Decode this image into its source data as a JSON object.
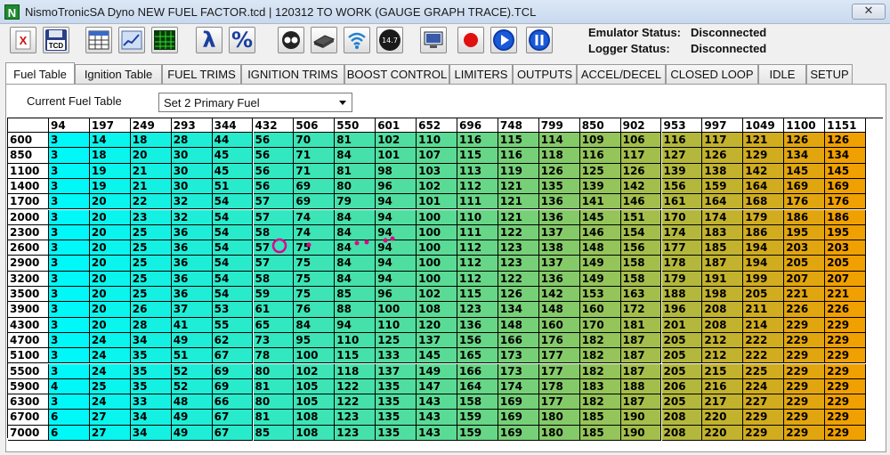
{
  "window": {
    "app_icon_letter": "N",
    "title": "NismoTronicSA  Dyno NEW FUEL FACTOR.tcd | 120312 TO WORK (GAUGE GRAPH TRACE).TCL",
    "close_glyph": "✕"
  },
  "toolbar": {
    "buttons": [
      {
        "name": "close-file-button",
        "icon": "excel-x-icon"
      },
      {
        "name": "save-tcd-button",
        "icon": "floppy-disk-icon",
        "label": "TCD"
      },
      {
        "name": "table-view-button",
        "icon": "table-icon"
      },
      {
        "name": "graph-view-button",
        "icon": "line-graph-icon"
      },
      {
        "name": "3d-map-button",
        "icon": "3d-map-icon"
      },
      {
        "name": "lambda-button",
        "icon": "lambda-icon",
        "label": "λ"
      },
      {
        "name": "percent-button",
        "icon": "percent-icon",
        "label": "%"
      },
      {
        "name": "gauges-button",
        "icon": "gauge-icon"
      },
      {
        "name": "chip-button",
        "icon": "chip-icon"
      },
      {
        "name": "wireless-button",
        "icon": "wireless-icon"
      },
      {
        "name": "afr-button",
        "icon": "afr-gauge-icon",
        "label": "14.7"
      },
      {
        "name": "monitor-button",
        "icon": "monitor-icon"
      },
      {
        "name": "record-button",
        "icon": "record-icon"
      },
      {
        "name": "play-button",
        "icon": "play-icon"
      },
      {
        "name": "pause-button",
        "icon": "pause-icon"
      }
    ],
    "emulator_label": "Emulator Status:",
    "emulator_value": "Disconnected",
    "logger_label": "Logger Status:",
    "logger_value": "Disconnected"
  },
  "tabs": [
    {
      "label": "Fuel Table",
      "active": true
    },
    {
      "label": "Ignition Table"
    },
    {
      "label": "FUEL TRIMS"
    },
    {
      "label": "IGNITION TRIMS"
    },
    {
      "label": "BOOST CONTROL"
    },
    {
      "label": "LIMITERS"
    },
    {
      "label": "OUTPUTS"
    },
    {
      "label": "ACCEL/DECEL"
    },
    {
      "label": "CLOSED LOOP"
    },
    {
      "label": "IDLE"
    },
    {
      "label": "SETUP"
    }
  ],
  "fuel_table": {
    "current_label": "Current Fuel Table",
    "selected": "Set 2 Primary Fuel",
    "columns": [
      "94",
      "197",
      "249",
      "293",
      "344",
      "432",
      "506",
      "550",
      "601",
      "652",
      "696",
      "748",
      "799",
      "850",
      "902",
      "953",
      "997",
      "1049",
      "1100",
      "1151"
    ],
    "rows": [
      "600",
      "850",
      "1100",
      "1400",
      "1700",
      "2000",
      "2300",
      "2600",
      "2900",
      "3200",
      "3500",
      "3900",
      "4300",
      "4700",
      "5100",
      "5500",
      "5900",
      "6300",
      "6700",
      "7000"
    ],
    "values": [
      [
        3,
        14,
        18,
        28,
        44,
        56,
        70,
        81,
        102,
        110,
        116,
        115,
        114,
        109,
        106,
        116,
        117,
        121,
        126,
        126
      ],
      [
        3,
        18,
        20,
        30,
        45,
        56,
        71,
        84,
        101,
        107,
        115,
        116,
        118,
        116,
        117,
        127,
        126,
        129,
        134,
        134
      ],
      [
        3,
        19,
        21,
        30,
        45,
        56,
        71,
        81,
        98,
        103,
        113,
        119,
        126,
        125,
        126,
        139,
        138,
        142,
        145,
        145
      ],
      [
        3,
        19,
        21,
        30,
        51,
        56,
        69,
        80,
        96,
        102,
        112,
        121,
        135,
        139,
        142,
        156,
        159,
        164,
        169,
        169
      ],
      [
        3,
        20,
        22,
        32,
        54,
        57,
        69,
        79,
        94,
        101,
        111,
        121,
        136,
        141,
        146,
        161,
        164,
        168,
        176,
        176
      ],
      [
        3,
        20,
        23,
        32,
        54,
        57,
        74,
        84,
        94,
        100,
        110,
        121,
        136,
        145,
        151,
        170,
        174,
        179,
        186,
        186
      ],
      [
        3,
        20,
        25,
        36,
        54,
        58,
        74,
        84,
        94,
        100,
        111,
        122,
        137,
        146,
        154,
        174,
        183,
        186,
        195,
        195
      ],
      [
        3,
        20,
        25,
        36,
        54,
        57,
        75,
        84,
        94,
        100,
        112,
        123,
        138,
        148,
        156,
        177,
        185,
        194,
        203,
        203
      ],
      [
        3,
        20,
        25,
        36,
        54,
        57,
        75,
        84,
        94,
        100,
        112,
        123,
        137,
        149,
        158,
        178,
        187,
        194,
        205,
        205
      ],
      [
        3,
        20,
        25,
        36,
        54,
        58,
        75,
        84,
        94,
        100,
        112,
        122,
        136,
        149,
        158,
        179,
        191,
        199,
        207,
        207
      ],
      [
        3,
        20,
        25,
        36,
        54,
        59,
        75,
        85,
        96,
        102,
        115,
        126,
        142,
        153,
        163,
        188,
        198,
        205,
        221,
        221
      ],
      [
        3,
        20,
        26,
        37,
        53,
        61,
        76,
        88,
        100,
        108,
        123,
        134,
        148,
        160,
        172,
        196,
        208,
        211,
        226,
        226
      ],
      [
        3,
        20,
        28,
        41,
        55,
        65,
        84,
        94,
        110,
        120,
        136,
        148,
        160,
        170,
        181,
        201,
        208,
        214,
        229,
        229
      ],
      [
        3,
        24,
        34,
        49,
        62,
        73,
        95,
        110,
        125,
        137,
        156,
        166,
        176,
        182,
        187,
        205,
        212,
        222,
        229,
        229
      ],
      [
        3,
        24,
        35,
        51,
        67,
        78,
        100,
        115,
        133,
        145,
        165,
        173,
        177,
        182,
        187,
        205,
        212,
        222,
        229,
        229
      ],
      [
        3,
        24,
        35,
        52,
        69,
        80,
        102,
        118,
        137,
        149,
        166,
        173,
        177,
        182,
        187,
        205,
        215,
        225,
        229,
        229
      ],
      [
        4,
        25,
        35,
        52,
        69,
        81,
        105,
        122,
        135,
        147,
        164,
        174,
        178,
        183,
        188,
        206,
        216,
        224,
        229,
        229
      ],
      [
        3,
        24,
        33,
        48,
        66,
        80,
        105,
        122,
        135,
        143,
        158,
        169,
        177,
        182,
        187,
        205,
        217,
        227,
        229,
        229
      ],
      [
        6,
        27,
        34,
        49,
        67,
        81,
        108,
        123,
        135,
        143,
        159,
        169,
        180,
        185,
        190,
        208,
        220,
        229,
        229,
        229
      ],
      [
        6,
        27,
        34,
        49,
        67,
        85,
        108,
        123,
        135,
        143,
        159,
        169,
        180,
        185,
        190,
        208,
        220,
        229,
        229,
        229
      ]
    ]
  },
  "colors": {
    "low": "#00f8f8",
    "mid": "#5fd98f",
    "high": "#f0a000",
    "trace": "#e0008a"
  }
}
